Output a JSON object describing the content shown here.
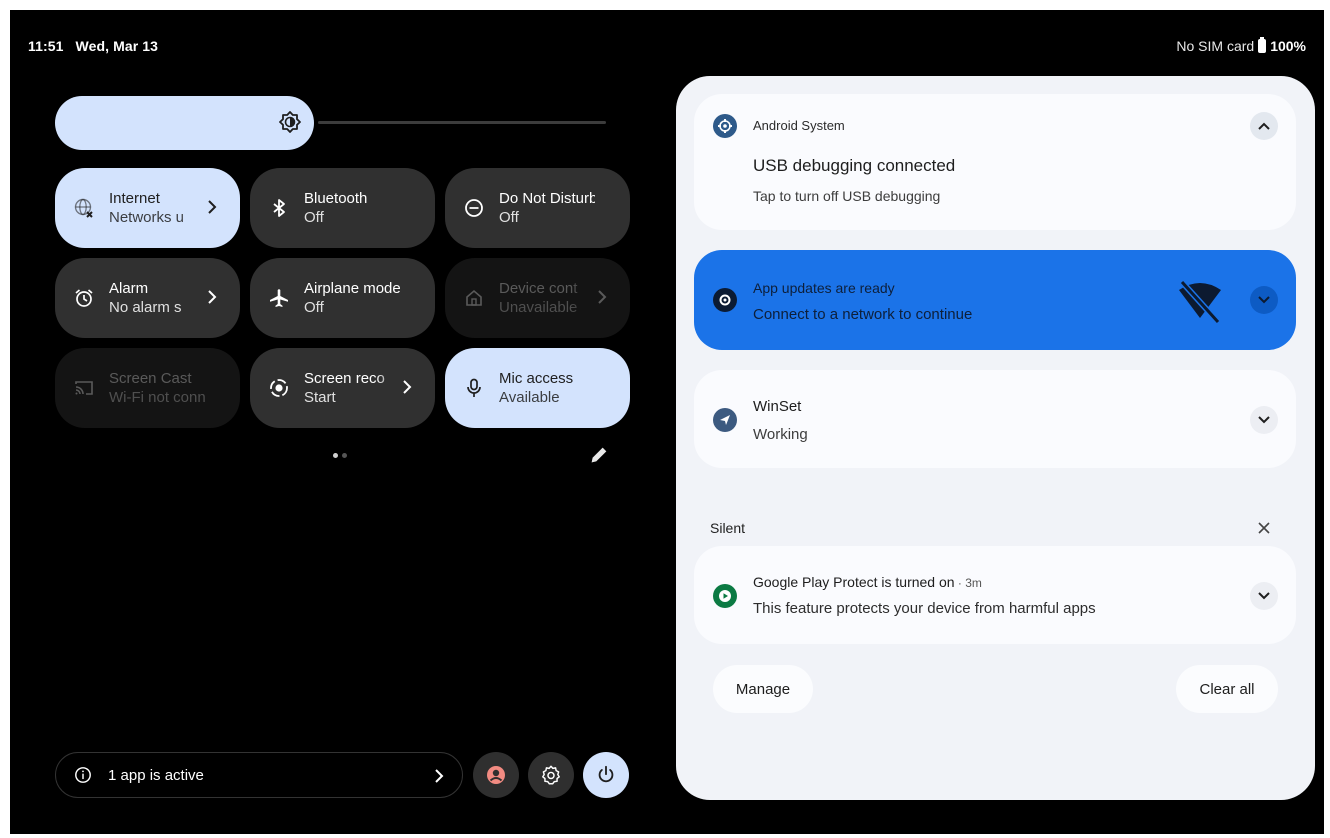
{
  "status_bar": {
    "time": "11:51",
    "date": "Wed, Mar 13",
    "sim": "No SIM card",
    "battery": "100%"
  },
  "brightness": {
    "level": 0.47
  },
  "tiles": [
    {
      "label": "Internet",
      "sub": "Networks u",
      "state": "active",
      "icon": "globe-x-icon",
      "chevron": true
    },
    {
      "label": "Bluetooth",
      "sub": "Off",
      "state": "off",
      "icon": "bluetooth-icon",
      "chevron": false
    },
    {
      "label": "Do Not Disturb",
      "sub": "Off",
      "state": "off",
      "icon": "dnd-icon",
      "chevron": false
    },
    {
      "label": "Alarm",
      "sub": "No alarm s",
      "state": "off",
      "icon": "alarm-icon",
      "chevron": true
    },
    {
      "label": "Airplane mode",
      "sub": "Off",
      "state": "off",
      "icon": "airplane-icon",
      "chevron": false
    },
    {
      "label": "Device cont",
      "sub": "Unavailable",
      "state": "disabled",
      "icon": "home-icon",
      "chevron": true
    },
    {
      "label": "Screen Cast",
      "sub": "Wi-Fi not conn",
      "state": "disabled",
      "icon": "cast-icon",
      "chevron": false
    },
    {
      "label": "Screen reco",
      "sub": "Start",
      "state": "off",
      "icon": "record-icon",
      "chevron": true
    },
    {
      "label": "Mic access",
      "sub": "Available",
      "state": "active",
      "icon": "mic-icon",
      "chevron": false
    }
  ],
  "footer": {
    "active_apps": "1 app is active"
  },
  "notifications": {
    "usb": {
      "app_name": "Android System",
      "title": "USB debugging connected",
      "body": "Tap to turn off USB debugging"
    },
    "updates": {
      "title": "App updates are ready",
      "body": "Connect to a network to continue"
    },
    "winset": {
      "title": "WinSet",
      "body": "Working"
    },
    "silent_header": "Silent",
    "play_protect": {
      "title": "Google Play Protect is turned on",
      "time": " · 3m",
      "body": "This feature protects your device from harmful apps"
    }
  },
  "actions": {
    "manage": "Manage",
    "clear_all": "Clear all"
  },
  "colors": {
    "tile_active": "#d3e3fd",
    "tile_off": "#303030",
    "panel_bg": "#f1f3f8",
    "highlight_card": "#1b73e8"
  }
}
